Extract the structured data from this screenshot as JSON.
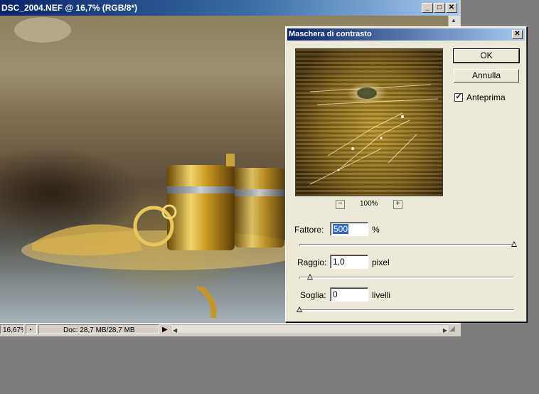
{
  "document": {
    "title": "DSC_2004.NEF @ 16,7% (RGB/8*)",
    "minimize": "_",
    "maximize": "□",
    "close": "✕",
    "status": {
      "zoom": "16,67%",
      "doc_info": "Doc: 28,7 MB/28,7 MB"
    }
  },
  "dialog": {
    "title": "Maschera di contrasto",
    "close": "✕",
    "ok_label": "OK",
    "cancel_label": "Annulla",
    "preview_label": "Anteprima",
    "preview_checked": true,
    "zoom_out": "−",
    "zoom_in": "+",
    "zoom_level": "100%",
    "amount": {
      "label": "Fattore:",
      "value": "500",
      "unit": "%",
      "slider_fraction": 1.0
    },
    "radius": {
      "label": "Raggio:",
      "value": "1,0",
      "unit": "pixel",
      "slider_fraction": 0.05
    },
    "threshold": {
      "label": "Soglia:",
      "value": "0",
      "unit": "livelli",
      "slider_fraction": 0.0
    }
  }
}
